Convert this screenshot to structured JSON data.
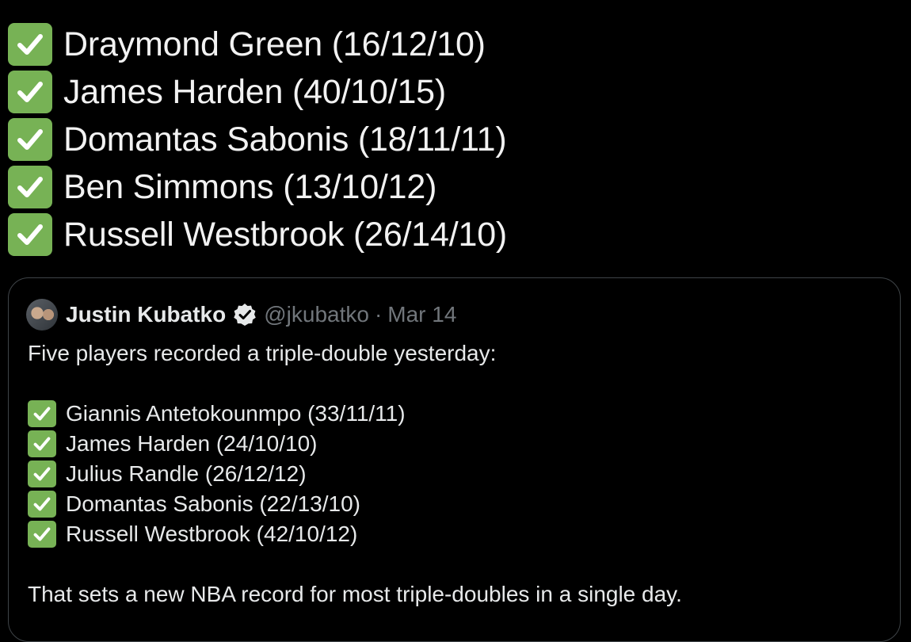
{
  "top_list": {
    "items": [
      {
        "icon": "white-check-mark-icon",
        "text": "Draymond Green (16/12/10)"
      },
      {
        "icon": "white-check-mark-icon",
        "text": "James Harden (40/10/15)"
      },
      {
        "icon": "white-check-mark-icon",
        "text": "Domantas Sabonis (18/11/11)"
      },
      {
        "icon": "white-check-mark-icon",
        "text": "Ben Simmons (13/10/12)"
      },
      {
        "icon": "white-check-mark-icon",
        "text": "Russell Westbrook (26/14/10)"
      }
    ]
  },
  "quoted_tweet": {
    "author_name": "Justin Kubatko",
    "verified": true,
    "handle": "@jkubatko",
    "separator": "·",
    "date": "Mar 14",
    "intro": "Five players recorded a triple-double yesterday:",
    "items": [
      {
        "icon": "white-check-mark-icon",
        "text": "Giannis Antetokounmpo (33/11/11)"
      },
      {
        "icon": "white-check-mark-icon",
        "text": "James Harden (24/10/10)"
      },
      {
        "icon": "white-check-mark-icon",
        "text": "Julius Randle (26/12/12)"
      },
      {
        "icon": "white-check-mark-icon",
        "text": "Domantas Sabonis (22/13/10)"
      },
      {
        "icon": "white-check-mark-icon",
        "text": "Russell Westbrook (42/10/12)"
      }
    ],
    "closing": "That sets a new NBA record for most triple-doubles in a single day."
  },
  "colors": {
    "background": "#000000",
    "check_green": "#77b255",
    "text_primary": "#e7e9ea",
    "text_secondary": "#71767b",
    "card_border": "#3f4448"
  }
}
